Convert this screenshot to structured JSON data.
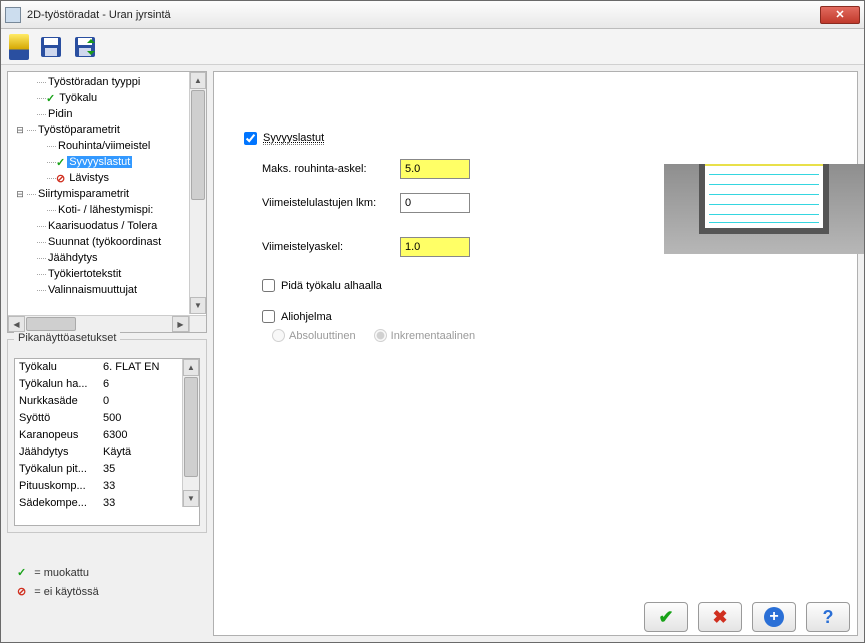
{
  "window": {
    "title": "2D-työstöradat - Uran jyrsintä"
  },
  "tree": {
    "items": [
      {
        "indent": 1,
        "label": "Työstöradan tyyppi"
      },
      {
        "indent": 1,
        "mark": "check",
        "label": "Työkalu"
      },
      {
        "indent": 1,
        "label": "Pidin"
      },
      {
        "indent": 0,
        "expander": "⊟",
        "label": "Työstöparametrit"
      },
      {
        "indent": 2,
        "label": "Rouhinta/viimeistel"
      },
      {
        "indent": 2,
        "mark": "check",
        "label": "Syvyyslastut",
        "selected": true
      },
      {
        "indent": 2,
        "mark": "forbid",
        "label": "Lävistys"
      },
      {
        "indent": 0,
        "expander": "⊟",
        "label": "Siirtymisparametrit"
      },
      {
        "indent": 2,
        "label": "Koti- / lähestymispi:"
      },
      {
        "indent": 1,
        "label": "Kaarisuodatus / Tolera"
      },
      {
        "indent": 1,
        "label": "Suunnat (työkoordinast"
      },
      {
        "indent": 1,
        "label": "Jäähdytys"
      },
      {
        "indent": 1,
        "label": "Työkiertotekstit"
      },
      {
        "indent": 1,
        "label": "Valinnaismuuttujat"
      }
    ]
  },
  "quickview": {
    "title": "Pikanäyttöasetukset",
    "rows": [
      {
        "k": "Työkalu",
        "v": "6. FLAT EN"
      },
      {
        "k": "Työkalun ha...",
        "v": "6"
      },
      {
        "k": "Nurkkasäde",
        "v": "0"
      },
      {
        "k": "Syöttö",
        "v": "500"
      },
      {
        "k": "Karanopeus",
        "v": "6300"
      },
      {
        "k": "Jäähdytys",
        "v": "Käytä"
      },
      {
        "k": "Työkalun pit...",
        "v": "35"
      },
      {
        "k": "Pituuskomp...",
        "v": "33"
      },
      {
        "k": "Sädekompe...",
        "v": "33"
      }
    ]
  },
  "form": {
    "depth_cuts_label": "Syvyyslastut",
    "max_rough_label": "Maks. rouhinta-askel:",
    "max_rough_value": "5.0",
    "finish_count_label": "Viimeistelulastujen lkm:",
    "finish_count_value": "0",
    "finish_step_label": "Viimeistelyaskel:",
    "finish_step_value": "1.0",
    "keep_tool_down_label": "Pidä työkalu alhaalla",
    "subprogram_label": "Aliohjelma",
    "absolute_label": "Absoluuttinen",
    "incremental_label": "Inkrementaalinen"
  },
  "legend": {
    "edited": "= muokattu",
    "disabled": "= ei käytössä"
  }
}
